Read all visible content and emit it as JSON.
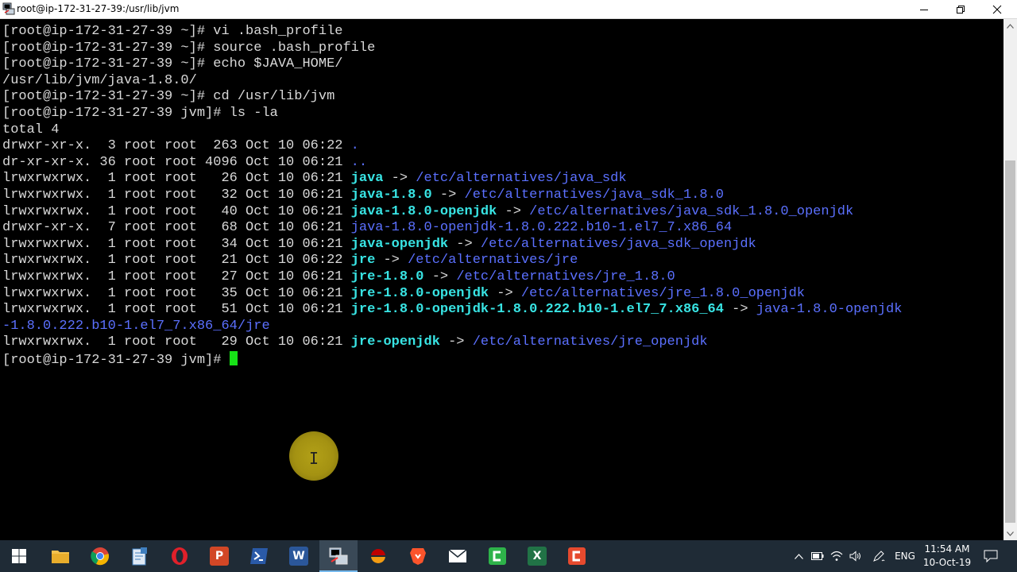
{
  "window": {
    "title": "root@ip-172-31-27-39:/usr/lib/jvm",
    "icon": "putty-icon"
  },
  "terminal": {
    "lines": [
      [
        {
          "t": "[root@ip-172-31-27-39 ~]# vi .bash_profile",
          "c": "n"
        }
      ],
      [
        {
          "t": "[root@ip-172-31-27-39 ~]# source .bash_profile",
          "c": "n"
        }
      ],
      [
        {
          "t": "[root@ip-172-31-27-39 ~]# echo $JAVA_HOME/",
          "c": "n"
        }
      ],
      [
        {
          "t": "/usr/lib/jvm/java-1.8.0/",
          "c": "n"
        }
      ],
      [
        {
          "t": "[root@ip-172-31-27-39 ~]# cd /usr/lib/jvm",
          "c": "n"
        }
      ],
      [
        {
          "t": "[root@ip-172-31-27-39 jvm]# ls -la",
          "c": "n"
        }
      ],
      [
        {
          "t": "total 4",
          "c": "n"
        }
      ],
      [
        {
          "t": "drwxr-xr-x.  3 root root  263 Oct 10 06:22 ",
          "c": "n"
        },
        {
          "t": ".",
          "c": "t"
        }
      ],
      [
        {
          "t": "dr-xr-xr-x. 36 root root 4096 Oct 10 06:21 ",
          "c": "n"
        },
        {
          "t": "..",
          "c": "t"
        }
      ],
      [
        {
          "t": "lrwxrwxrwx.  1 root root   26 Oct 10 06:21 ",
          "c": "n"
        },
        {
          "t": "java",
          "c": "l"
        },
        {
          "t": " -> ",
          "c": "n"
        },
        {
          "t": "/etc/alternatives/java_sdk",
          "c": "t"
        }
      ],
      [
        {
          "t": "lrwxrwxrwx.  1 root root   32 Oct 10 06:21 ",
          "c": "n"
        },
        {
          "t": "java-1.8.0",
          "c": "l"
        },
        {
          "t": " -> ",
          "c": "n"
        },
        {
          "t": "/etc/alternatives/java_sdk_1.8.0",
          "c": "t"
        }
      ],
      [
        {
          "t": "lrwxrwxrwx.  1 root root   40 Oct 10 06:21 ",
          "c": "n"
        },
        {
          "t": "java-1.8.0-openjdk",
          "c": "l"
        },
        {
          "t": " -> ",
          "c": "n"
        },
        {
          "t": "/etc/alternatives/java_sdk_1.8.0_openjdk",
          "c": "t"
        }
      ],
      [
        {
          "t": "drwxr-xr-x.  7 root root   68 Oct 10 06:21 ",
          "c": "n"
        },
        {
          "t": "java-1.8.0-openjdk-1.8.0.222.b10-1.el7_7.x86_64",
          "c": "t"
        }
      ],
      [
        {
          "t": "lrwxrwxrwx.  1 root root   34 Oct 10 06:21 ",
          "c": "n"
        },
        {
          "t": "java-openjdk",
          "c": "l"
        },
        {
          "t": " -> ",
          "c": "n"
        },
        {
          "t": "/etc/alternatives/java_sdk_openjdk",
          "c": "t"
        }
      ],
      [
        {
          "t": "lrwxrwxrwx.  1 root root   21 Oct 10 06:22 ",
          "c": "n"
        },
        {
          "t": "jre",
          "c": "l"
        },
        {
          "t": " -> ",
          "c": "n"
        },
        {
          "t": "/etc/alternatives/jre",
          "c": "t"
        }
      ],
      [
        {
          "t": "lrwxrwxrwx.  1 root root   27 Oct 10 06:21 ",
          "c": "n"
        },
        {
          "t": "jre-1.8.0",
          "c": "l"
        },
        {
          "t": " -> ",
          "c": "n"
        },
        {
          "t": "/etc/alternatives/jre_1.8.0",
          "c": "t"
        }
      ],
      [
        {
          "t": "lrwxrwxrwx.  1 root root   35 Oct 10 06:21 ",
          "c": "n"
        },
        {
          "t": "jre-1.8.0-openjdk",
          "c": "l"
        },
        {
          "t": " -> ",
          "c": "n"
        },
        {
          "t": "/etc/alternatives/jre_1.8.0_openjdk",
          "c": "t"
        }
      ],
      [
        {
          "t": "lrwxrwxrwx.  1 root root   51 Oct 10 06:21 ",
          "c": "n"
        },
        {
          "t": "jre-1.8.0-openjdk-1.8.0.222.b10-1.el7_7.x86_64",
          "c": "l"
        },
        {
          "t": " -> ",
          "c": "n"
        },
        {
          "t": "java-1.8.0-openjdk",
          "c": "t"
        }
      ],
      [
        {
          "t": "-1.8.0.222.b10-1.el7_7.x86_64/jre",
          "c": "t"
        }
      ],
      [
        {
          "t": "lrwxrwxrwx.  1 root root   29 Oct 10 06:21 ",
          "c": "n"
        },
        {
          "t": "jre-openjdk",
          "c": "l"
        },
        {
          "t": " -> ",
          "c": "n"
        },
        {
          "t": "/etc/alternatives/jre_openjdk",
          "c": "t"
        }
      ],
      [
        {
          "t": "[root@ip-172-31-27-39 jvm]# ",
          "c": "n"
        },
        {
          "t": "",
          "c": "cursor"
        }
      ]
    ],
    "colors": {
      "text": "#d9d9d9",
      "symlink": "#38e4e4",
      "target": "#5b70ff",
      "cursor": "#17e217",
      "background": "#000000"
    }
  },
  "taskbar": {
    "apps": [
      {
        "name": "file-explorer-icon",
        "color": "#f2c14e"
      },
      {
        "name": "chrome-icon",
        "color": "#4285f4"
      },
      {
        "name": "notepad-icon",
        "color": "#3f7fbf"
      },
      {
        "name": "opera-icon",
        "color": "#e0202a"
      },
      {
        "name": "powerpoint-icon",
        "color": "#d24726",
        "letter": "P"
      },
      {
        "name": "powershell-icon",
        "color": "#2a5aa8"
      },
      {
        "name": "word-icon",
        "color": "#2b579a",
        "letter": "W"
      },
      {
        "name": "putty-icon",
        "color": "#7b8fa8",
        "active": true
      },
      {
        "name": "filezilla-icon",
        "color": "#bf0000"
      },
      {
        "name": "brave-icon",
        "color": "#fb542b"
      },
      {
        "name": "mail-icon",
        "color": "#ffffff"
      },
      {
        "name": "camtasia-icon",
        "color": "#2eb34a"
      },
      {
        "name": "excel-icon",
        "color": "#217346",
        "letter": "X"
      },
      {
        "name": "camtasia-recorder-icon",
        "color": "#e64a2e"
      }
    ],
    "language": "ENG",
    "time": "11:54 AM",
    "date": "10-Oct-19"
  }
}
